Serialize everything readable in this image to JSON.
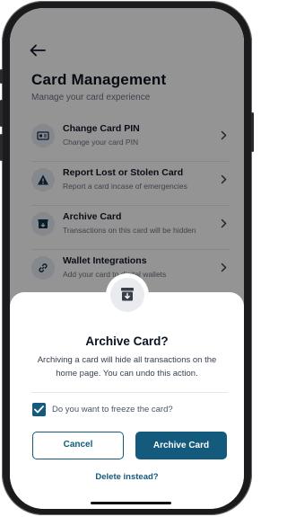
{
  "header": {
    "title": "Card Management",
    "subtitle": "Manage your card experience"
  },
  "icons": {
    "back": "arrow-left-icon",
    "chevron": "chevron-right-icon"
  },
  "menu": [
    {
      "label": "Change Card PIN",
      "sub": "Change your card PIN",
      "icon": "pin-card-icon"
    },
    {
      "label": "Report Lost or Stolen Card",
      "sub": "Report a card incase of emergencies",
      "icon": "warning-icon"
    },
    {
      "label": "Archive Card",
      "sub": "Transactions on this card will be hidden",
      "icon": "archive-icon"
    },
    {
      "label": "Wallet Integrations",
      "sub": "Add your card to digital wallets",
      "icon": "link-icon"
    }
  ],
  "dialog": {
    "icon": "archive-box-icon",
    "title": "Archive Card?",
    "body": "Archiving a card will hide all transactions on the home page. You can undo this action.",
    "checkbox_label": "Do you want to freeze the card?",
    "checkbox_checked": true,
    "cancel_label": "Cancel",
    "confirm_label": "Archive Card",
    "secondary_link": "Delete instead?"
  },
  "colors": {
    "primary": "#135a7c",
    "title": "#0c1320",
    "overlay": "rgba(0,0,0,0.42)"
  }
}
